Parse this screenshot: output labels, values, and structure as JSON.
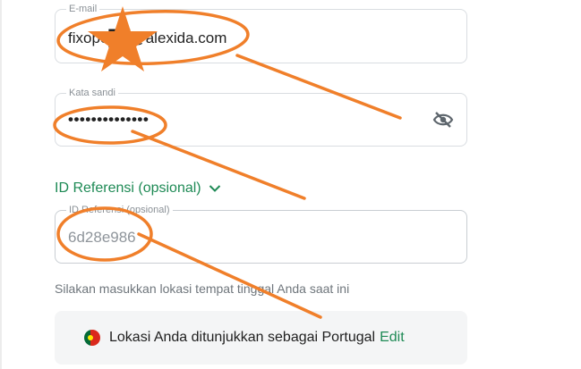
{
  "email": {
    "label": "E-mail",
    "value": "fixope██@alexida.com"
  },
  "password": {
    "label": "Kata sandi",
    "value": "••••••••••••••"
  },
  "referral": {
    "toggle_label": "ID Referensi (opsional)",
    "field_label": "ID Referensi (opsional)",
    "value": "6d28e986"
  },
  "location": {
    "hint": "Silakan masukkan lokasi tempat tinggal Anda saat ini",
    "text": "Lokasi Anda ditunjukkan sebagai Portugal",
    "edit_label": "Edit"
  },
  "colors": {
    "accent": "#1e8a55",
    "annotation": "#f07f2a"
  }
}
